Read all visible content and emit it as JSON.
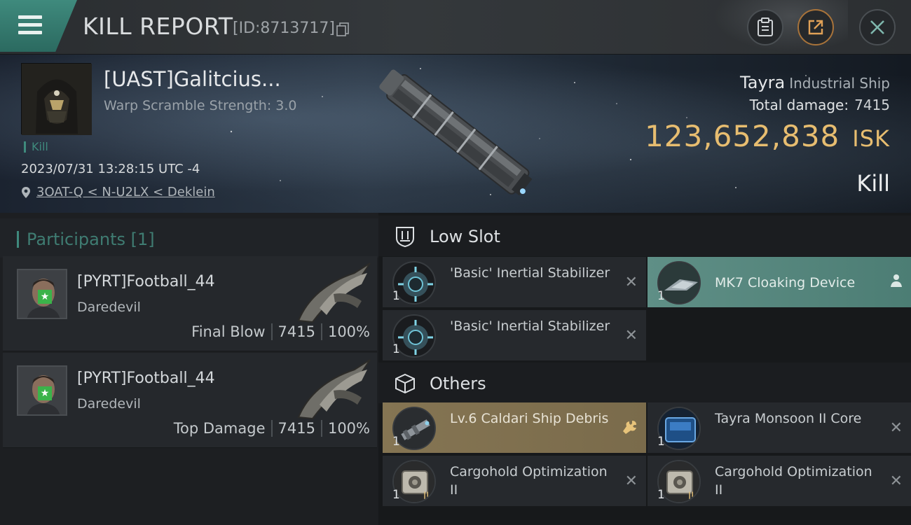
{
  "header": {
    "title": "KILL REPORT",
    "id_label": "[ID:8713717]"
  },
  "victim": {
    "name": "[UAST]Galitcius...",
    "warp": "Warp Scramble Strength: 3.0",
    "tag": "Kill",
    "date": "2023/07/31 13:28:15 UTC -4",
    "location": "3OAT-Q < N-U2LX < Deklein"
  },
  "ship": {
    "name": "Tayra",
    "class": "Industrial Ship",
    "total_damage_label": "Total damage:",
    "total_damage": "7415",
    "isk_value": "123,652,838",
    "isk_unit": "ISK",
    "result": "Kill"
  },
  "participants": {
    "label": "Participants [1]",
    "rows": [
      {
        "name": "[PYRT]Football_44",
        "ship": "Daredevil",
        "role": "Final Blow",
        "damage": "7415",
        "percent": "100%"
      },
      {
        "name": "[PYRT]Football_44",
        "ship": "Daredevil",
        "role": "Top Damage",
        "damage": "7415",
        "percent": "100%"
      }
    ]
  },
  "low_slot": {
    "label": "Low Slot",
    "items": [
      {
        "qty": "1",
        "name": "'Basic' Inertial Stabilizer",
        "status": "destroyed"
      },
      {
        "qty": "1",
        "name": "MK7 Cloaking Device",
        "status": "dropped"
      },
      {
        "qty": "1",
        "name": "'Basic' Inertial Stabilizer",
        "status": "destroyed"
      }
    ]
  },
  "others": {
    "label": "Others",
    "items": [
      {
        "qty": "1",
        "name": "Lv.6 Caldari Ship Debris",
        "status": "debris"
      },
      {
        "qty": "1",
        "name": "Tayra Monsoon II Core",
        "status": "destroyed"
      },
      {
        "qty": "1",
        "name": "Cargohold Optimization II",
        "status": "destroyed"
      },
      {
        "qty": "1",
        "name": "Cargohold Optimization II",
        "status": "destroyed"
      }
    ]
  },
  "colors": {
    "accent": "#3f8a7d",
    "isk": "#e7bd70",
    "debris": "#857553"
  }
}
